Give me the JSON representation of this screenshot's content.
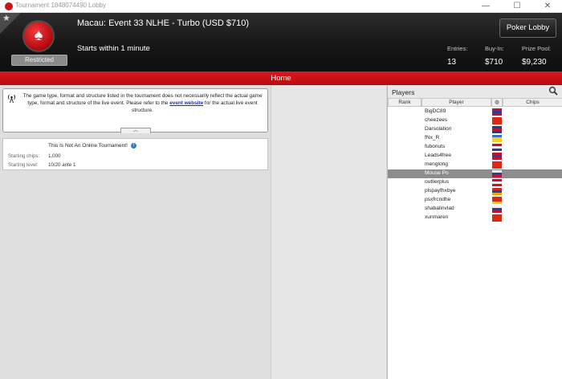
{
  "window": {
    "title": "Tournament 1848074490 Lobby",
    "controls": [
      "—",
      "☐",
      "✕"
    ]
  },
  "header": {
    "star": "★",
    "restricted_label": "Restricted",
    "event_title": "Macau: Event 33 NLHE - Turbo (USD $710)",
    "starts_text": "Starts within 1 minute",
    "lobby_button": "Poker Lobby",
    "stats": {
      "entries_label": "Entries:",
      "entries_value": "13",
      "buyin_label": "Buy-In:",
      "buyin_value": "$710",
      "prize_label": "Prize Pool:",
      "prize_value": "$9,230"
    }
  },
  "home_bar": {
    "label": "Home"
  },
  "notice": {
    "text_before": "The game type, format and structure listed in the tournament does not necessarily reflect the actual game type, format and structure of the live event. Please refer to the ",
    "link_text": "event website",
    "text_after": " for the actual live event structure.",
    "collapse": "︿"
  },
  "info": {
    "heading": "This Is Not An Online Tournament!",
    "info_glyph": "i",
    "chips_label": "Starting chips:",
    "chips_value": "1,000",
    "level_label": "Starting level:",
    "level_value": "10/20 ante 1"
  },
  "players": {
    "title": "Players",
    "columns": {
      "rank": "Rank",
      "player": "Player",
      "flag_col": "◍",
      "chips": "Chips"
    },
    "rows": [
      {
        "name": "BigDC89",
        "flag": [
          "#c8102e",
          "#2a3f9b",
          "#c8102e"
        ]
      },
      {
        "name": "cheezees",
        "flag": [
          "#de2910",
          "#de2910",
          "#de2910"
        ]
      },
      {
        "name": "Darsolation",
        "flag": [
          "#1a3f9b",
          "#c8102e",
          "#1a3f9b"
        ]
      },
      {
        "name": "fNx_R",
        "flag": [
          "#3a6fc9",
          "#f5d020",
          "#f5d020"
        ]
      },
      {
        "name": "fubonuts",
        "flag": [
          "#c8102e",
          "#f0f0f0",
          "#2a3f9b"
        ]
      },
      {
        "name": "Leads4free",
        "flag": [
          "#c8102e",
          "#2a3f9b",
          "#c8102e"
        ]
      },
      {
        "name": "menglong",
        "flag": [
          "#de2910",
          "#de2910",
          "#de2910"
        ]
      },
      {
        "name": "Mouse Po",
        "flag": [
          "#f0f0f0",
          "#2a3f9b",
          "#c8102e"
        ],
        "selected": true
      },
      {
        "name": "outlierplus",
        "flag": [
          "#c8102e",
          "#f0f0f0",
          "#c8102e"
        ]
      },
      {
        "name": "plspayfhxbye",
        "flag": [
          "#d52b1e",
          "#0052b4",
          "#ff9d00"
        ]
      },
      {
        "name": "psxfrcndhe",
        "flag": [
          "#da251d",
          "#da251d",
          "#ffcd00"
        ]
      },
      {
        "name": "shabalinvlad",
        "flag": [
          "#f0f0f0",
          "#2a3f9b",
          "#c8102e"
        ]
      },
      {
        "name": "xunmaren",
        "flag": [
          "#de2910",
          "#de2910",
          "#de2910"
        ]
      }
    ]
  }
}
